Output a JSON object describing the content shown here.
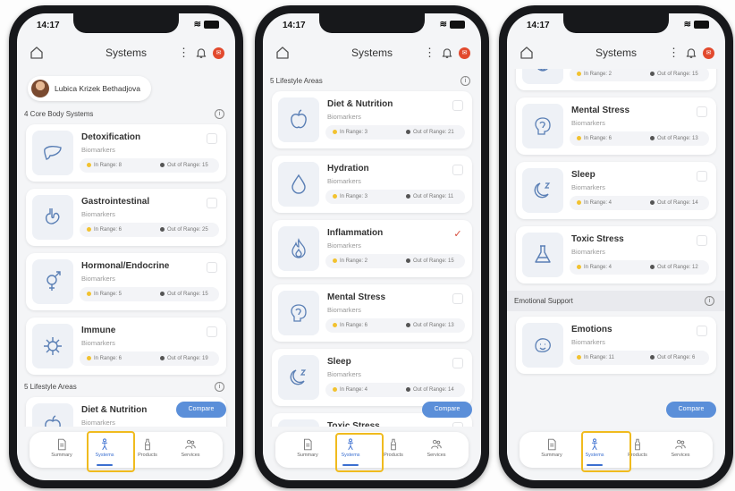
{
  "status": {
    "time": "14:17"
  },
  "header": {
    "title": "Systems",
    "kebab": "⋮"
  },
  "user": {
    "name": "Lubica Krizek Bethadjova"
  },
  "labels": {
    "biomarkers": "Biomarkers",
    "compare": "Compare"
  },
  "sections": {
    "core": "4 Core Body Systems",
    "lifestyle": "5 Lifestyle Areas",
    "emotional": "Emotional Support"
  },
  "systems": [
    {
      "name": "Detoxification",
      "in_range": "In Range: 8",
      "out_range": "Out of Range: 15",
      "icon": "liver-icon"
    },
    {
      "name": "Gastrointestinal",
      "in_range": "In Range: 6",
      "out_range": "Out of Range: 25",
      "icon": "stomach-icon"
    },
    {
      "name": "Hormonal/Endocrine",
      "in_range": "In Range: 5",
      "out_range": "Out of Range: 15",
      "icon": "gender-icon"
    },
    {
      "name": "Immune",
      "in_range": "In Range: 6",
      "out_range": "Out of Range: 19",
      "icon": "virus-icon"
    },
    {
      "name": "Diet & Nutrition",
      "in_range": "In Range: 3",
      "out_range": "Out of Range: 21",
      "icon": "apple-icon"
    },
    {
      "name": "Hydration",
      "in_range": "In Range: 3",
      "out_range": "Out of Range: 11",
      "icon": "drop-icon"
    },
    {
      "name": "Inflammation",
      "in_range": "In Range: 2",
      "out_range": "Out of Range: 15",
      "icon": "flame-icon",
      "checked": true
    },
    {
      "name": "Mental Stress",
      "in_range": "In Range: 6",
      "out_range": "Out of Range: 13",
      "icon": "brain-icon"
    },
    {
      "name": "Sleep",
      "in_range": "In Range: 4",
      "out_range": "Out of Range: 14",
      "icon": "moon-icon"
    },
    {
      "name": "Toxic Stress",
      "in_range": "In Range: 4",
      "out_range": "Out of Range: 12",
      "icon": "flask-icon"
    },
    {
      "name": "Emotions",
      "in_range": "In Range: 11",
      "out_range": "Out of Range: 6",
      "icon": "emotions-icon"
    }
  ],
  "tabs": [
    {
      "label": "Summary",
      "icon": "document-icon"
    },
    {
      "label": "Systems",
      "icon": "body-icon"
    },
    {
      "label": "Products",
      "icon": "bottle-icon"
    },
    {
      "label": "Services",
      "icon": "people-icon"
    }
  ],
  "active_tab": "Systems",
  "colors": {
    "accent": "#3b6fd0",
    "highlight": "#f0bb1e",
    "in_range_dot": "#f2c230",
    "notification": "#e24a2e",
    "check": "#d64a3a"
  }
}
